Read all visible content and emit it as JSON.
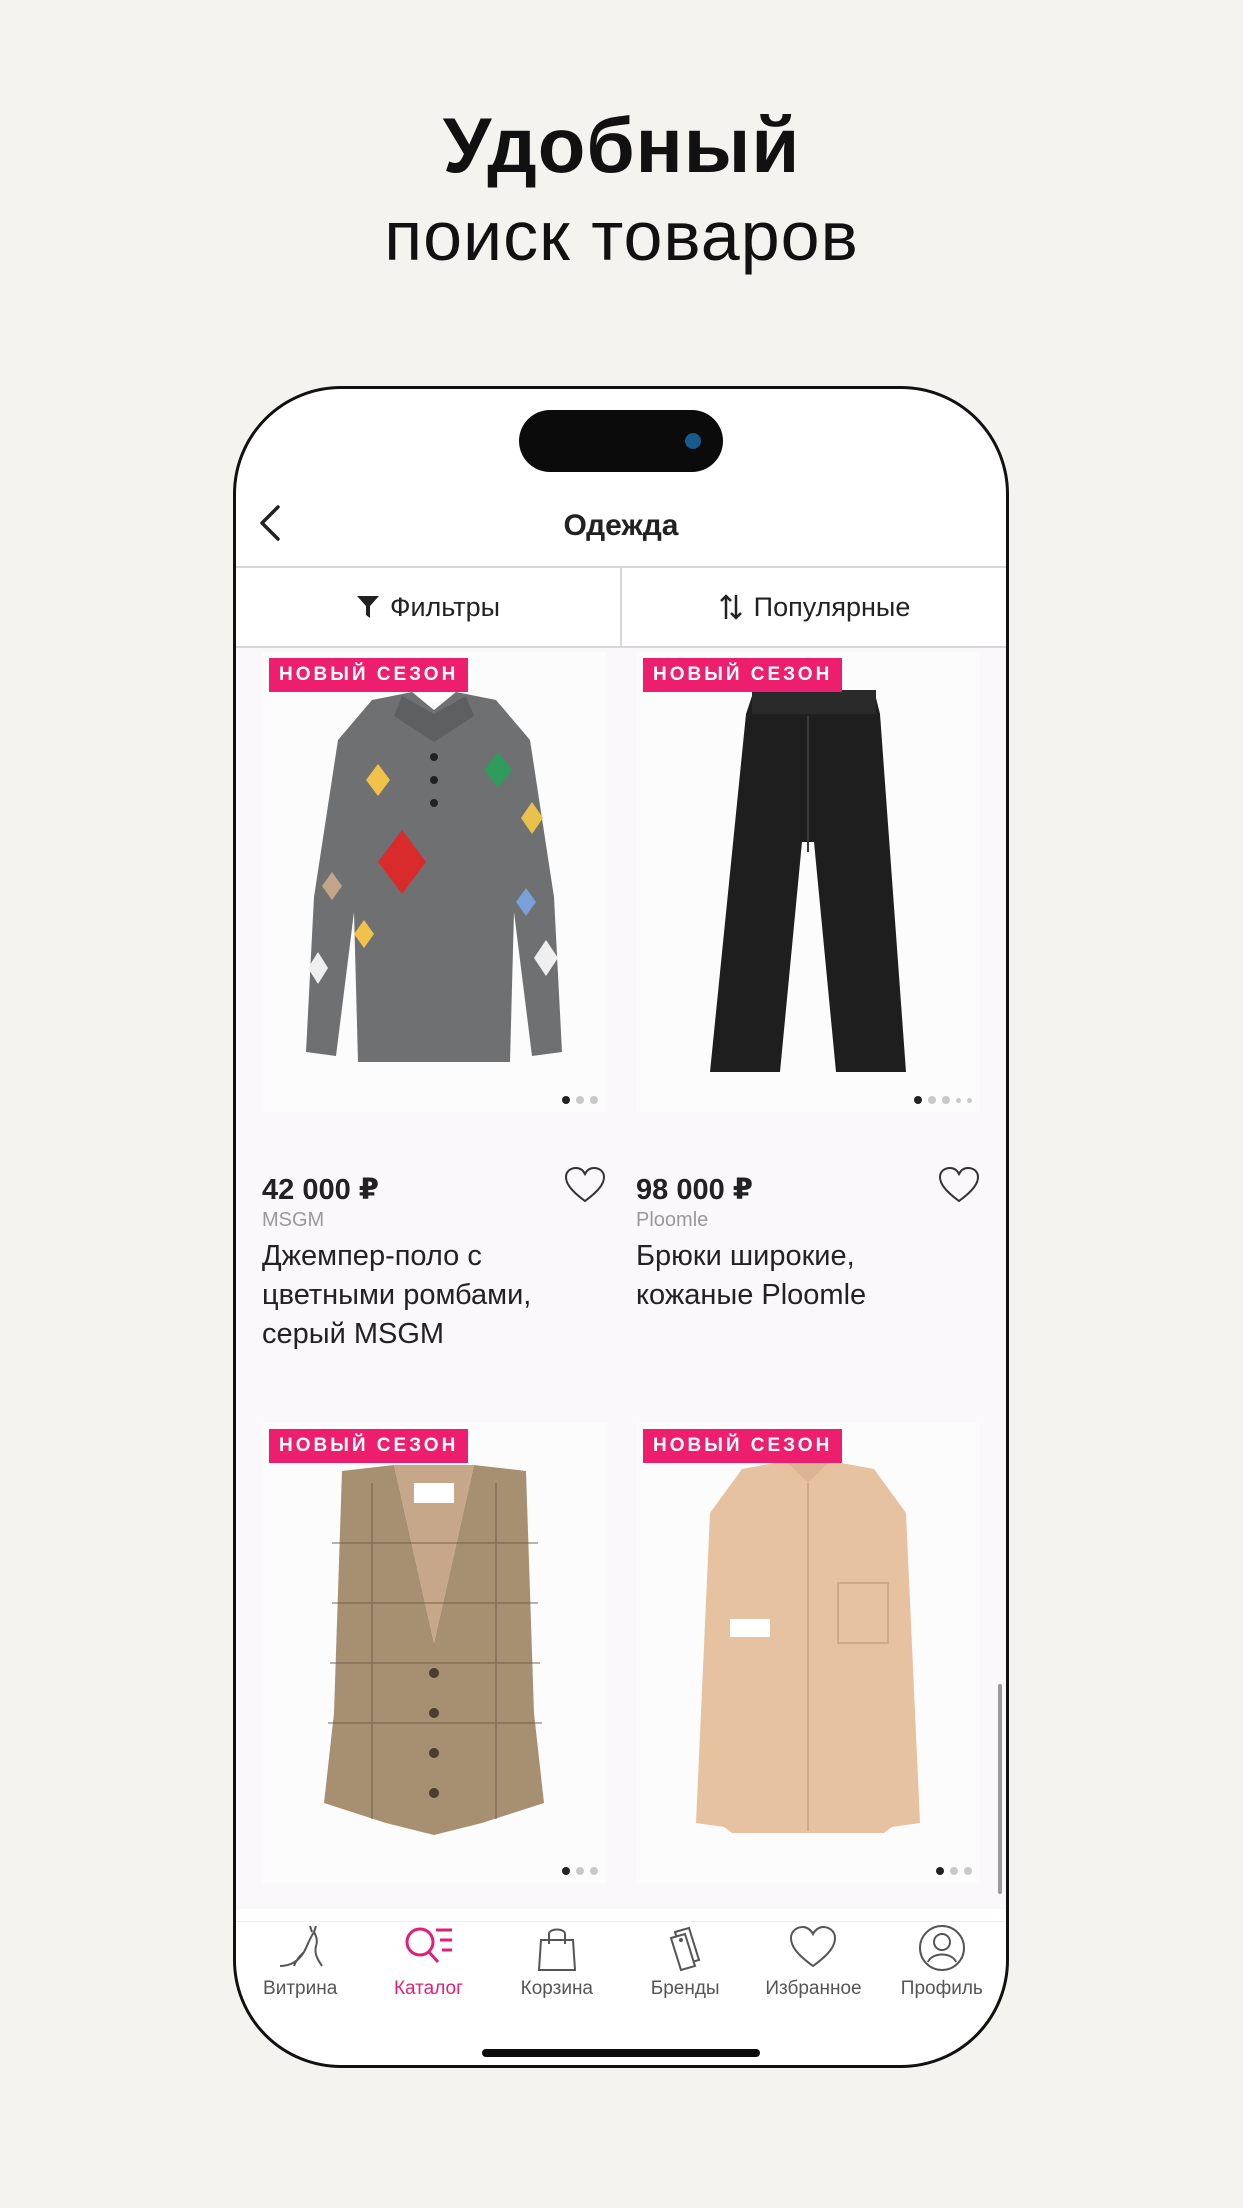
{
  "promo": {
    "title": "Удобный",
    "subtitle": "поиск товаров"
  },
  "nav": {
    "title": "Одежда"
  },
  "toolbar": {
    "filters_label": "Фильтры",
    "sort_label": "Популярные"
  },
  "colors": {
    "accent": "#e21e78",
    "badge": "#ed1e6e"
  },
  "products": [
    {
      "badge": "НОВЫЙ СЕЗОН",
      "price": "42 000 ₽",
      "brand": "MSGM",
      "name": "Джемпер-поло с цветными ромбами, серый MSGM",
      "image_dots": 3,
      "active_dot": 1
    },
    {
      "badge": "НОВЫЙ СЕЗОН",
      "price": "98 000 ₽",
      "brand": "Ploomle",
      "name": "Брюки широкие, кожаные Ploomle",
      "image_dots": 5,
      "active_dot": 1
    },
    {
      "badge": "НОВЫЙ СЕЗОН",
      "image_dots": 3,
      "active_dot": 1
    },
    {
      "badge": "НОВЫЙ СЕЗОН",
      "image_dots": 3,
      "active_dot": 1
    }
  ],
  "tabs": [
    {
      "label": "Витрина",
      "icon": "kangaroo-logo-icon",
      "active": false
    },
    {
      "label": "Каталог",
      "icon": "catalog-search-icon",
      "active": true
    },
    {
      "label": "Корзина",
      "icon": "shopping-bag-icon",
      "active": false
    },
    {
      "label": "Бренды",
      "icon": "tags-icon",
      "active": false
    },
    {
      "label": "Избранное",
      "icon": "heart-icon",
      "active": false
    },
    {
      "label": "Профиль",
      "icon": "profile-icon",
      "active": false
    }
  ]
}
